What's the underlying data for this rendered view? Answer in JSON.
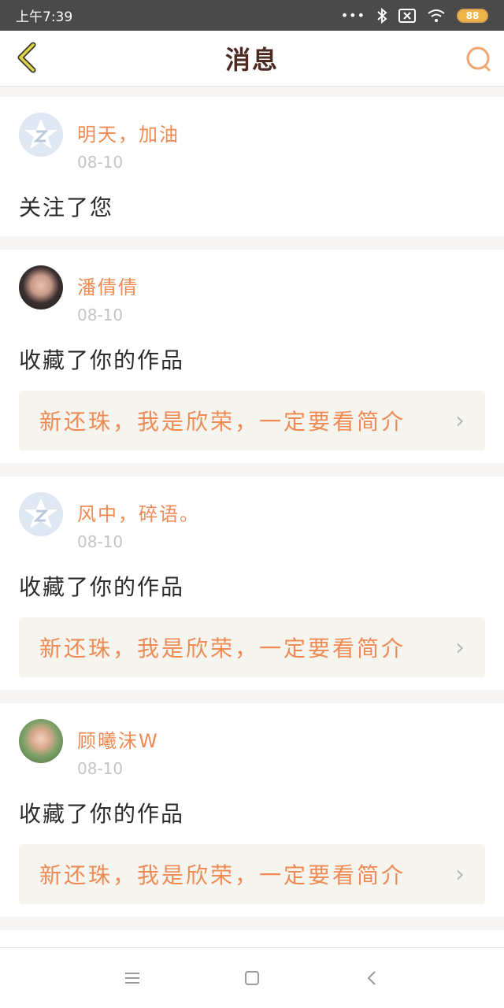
{
  "status_bar": {
    "time": "上午7:39",
    "battery": "88",
    "dots": "•••"
  },
  "header": {
    "title": "消息",
    "back_icon": "chevron-left-icon",
    "search_icon": "search-icon"
  },
  "messages": [
    {
      "username": "明天，加油",
      "date": "08-10",
      "action": "关注了您",
      "avatar": "default-avatar"
    },
    {
      "username": "潘倩倩",
      "date": "08-10",
      "action": "收藏了你的作品",
      "work_title": "新还珠，我是欣荣，一定要看简介",
      "avatar": "photo"
    },
    {
      "username": "风中，碎语。",
      "date": "08-10",
      "action": "收藏了你的作品",
      "work_title": "新还珠，我是欣荣，一定要看简介",
      "avatar": "default-avatar"
    },
    {
      "username": "顾曦沫W",
      "date": "08-10",
      "action": "收藏了你的作品",
      "work_title": "新还珠，我是欣荣，一定要看简介",
      "avatar": "photo"
    }
  ],
  "nav": {
    "menu_icon": "menu-icon",
    "home_icon": "home-square-icon",
    "back_icon": "back-arrow-icon"
  },
  "colors": {
    "accent": "#ef8a54",
    "title": "#4b2a22",
    "back_icon": "#d9c84a"
  }
}
